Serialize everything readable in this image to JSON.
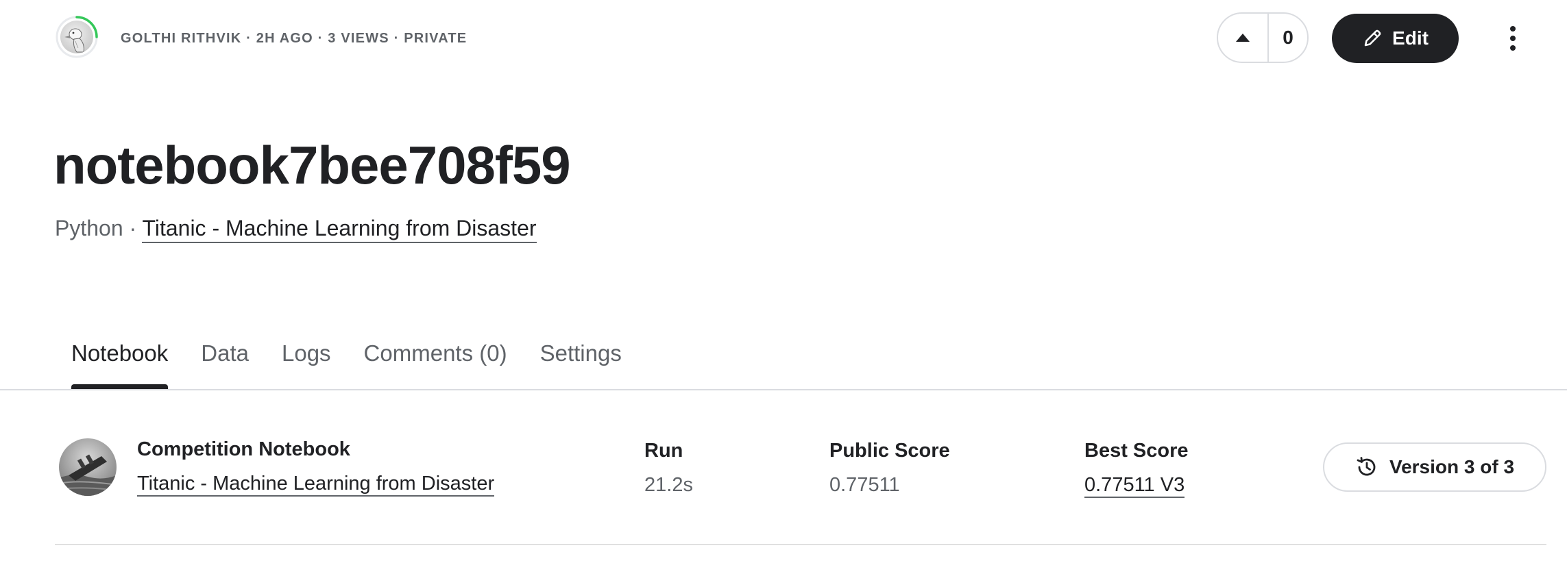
{
  "header": {
    "meta": "GOLTHI RITHVIK · 2H AGO · 3 VIEWS · PRIVATE",
    "vote_count": "0",
    "edit_label": "Edit"
  },
  "notebook": {
    "title": "notebook7bee708f59",
    "language": "Python",
    "separator": " · ",
    "competition_link": "Titanic - Machine Learning from Disaster"
  },
  "tabs": [
    {
      "label": "Notebook",
      "active": true
    },
    {
      "label": "Data",
      "active": false
    },
    {
      "label": "Logs",
      "active": false
    },
    {
      "label": "Comments (0)",
      "active": false
    },
    {
      "label": "Settings",
      "active": false
    }
  ],
  "info": {
    "competition_label": "Competition Notebook",
    "competition_name": "Titanic - Machine Learning from Disaster",
    "run_label": "Run",
    "run_value": "21.2s",
    "public_score_label": "Public Score",
    "public_score_value": "0.77511",
    "best_score_label": "Best Score",
    "best_score_value": "0.77511 V3",
    "version_label": "Version 3 of 3"
  },
  "icons": {
    "upvote": "caret-up-icon",
    "edit": "pencil-icon",
    "more": "kebab-menu-icon",
    "version": "history-icon"
  },
  "colors": {
    "primary_dark": "#202124",
    "secondary_text": "#5f6368",
    "border": "#dadce0",
    "progress_ring": "#34c759"
  }
}
